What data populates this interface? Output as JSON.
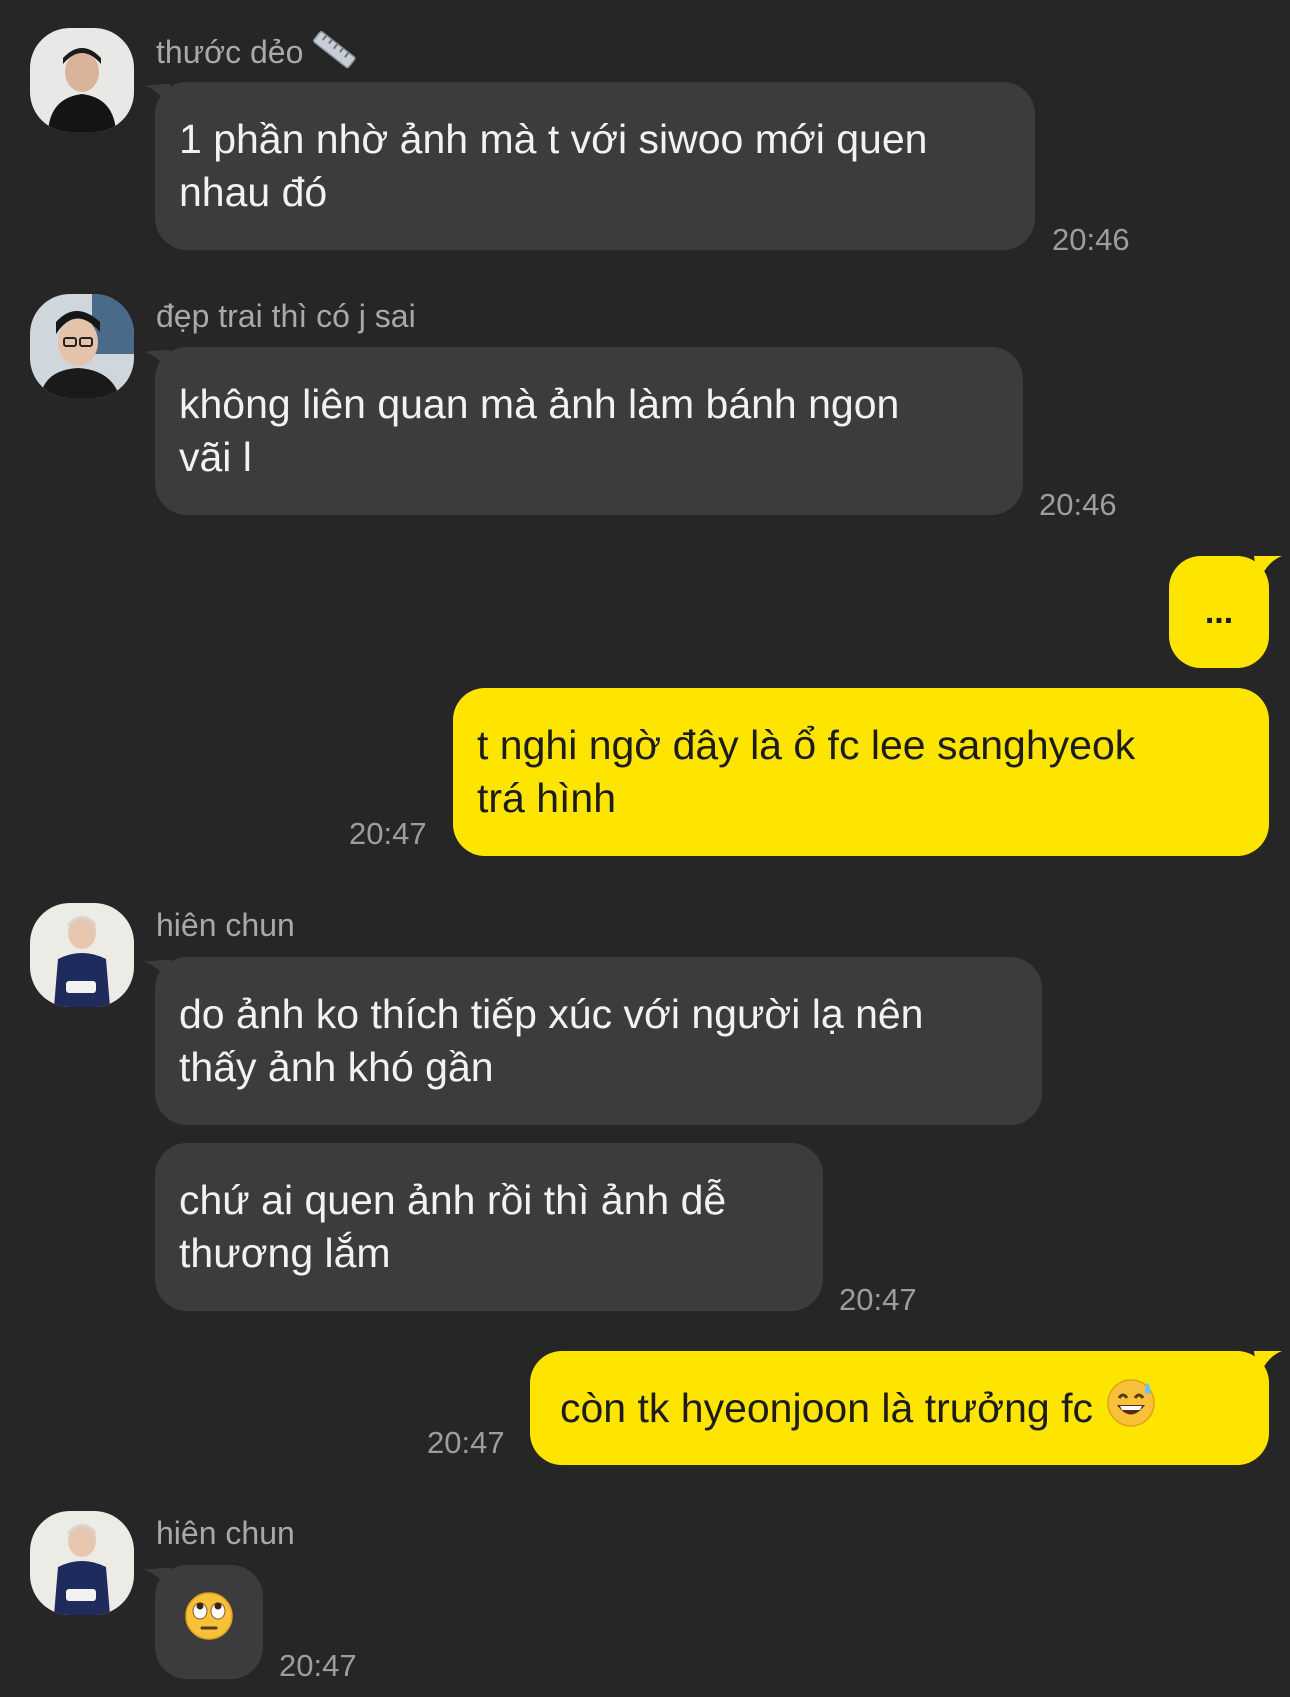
{
  "messages": [
    {
      "sender": "thước dẻo",
      "sender_emoji": "straight-ruler-icon",
      "lines": [
        "1 phần nhờ ảnh mà t với siwoo mới quen",
        "nhau đó"
      ],
      "time": "20:46"
    },
    {
      "sender": "đẹp trai thì có j sai",
      "lines": [
        "không liên quan mà ảnh làm bánh ngon",
        "vãi l"
      ],
      "time": "20:46"
    },
    {
      "outgoing": true,
      "lines": [
        "..."
      ]
    },
    {
      "outgoing": true,
      "lines": [
        "t nghi ngờ đây là ổ fc lee sanghyeok",
        "trá hình"
      ],
      "time": "20:47"
    },
    {
      "sender": "hiên chun",
      "lines": [
        "do ảnh ko thích tiếp xúc với người lạ nên",
        "thấy ảnh khó gần"
      ]
    },
    {
      "lines": [
        "chứ ai quen ảnh rồi thì ảnh dễ",
        "thương lắm"
      ],
      "time": "20:47"
    },
    {
      "outgoing": true,
      "lines": [
        "còn tk hyeonjoon là trưởng fc"
      ],
      "emoji": "grinning-sweat-icon",
      "time": "20:47"
    },
    {
      "sender": "hiên chun",
      "emoji": "eye-roll-icon",
      "time": "20:47"
    }
  ],
  "colors": {
    "background": "#262627",
    "incoming_bubble": "#3c3c3e",
    "outgoing_bubble": "#fee500",
    "sender_text": "#a9a9ab",
    "time_text": "#9d9d9f"
  }
}
